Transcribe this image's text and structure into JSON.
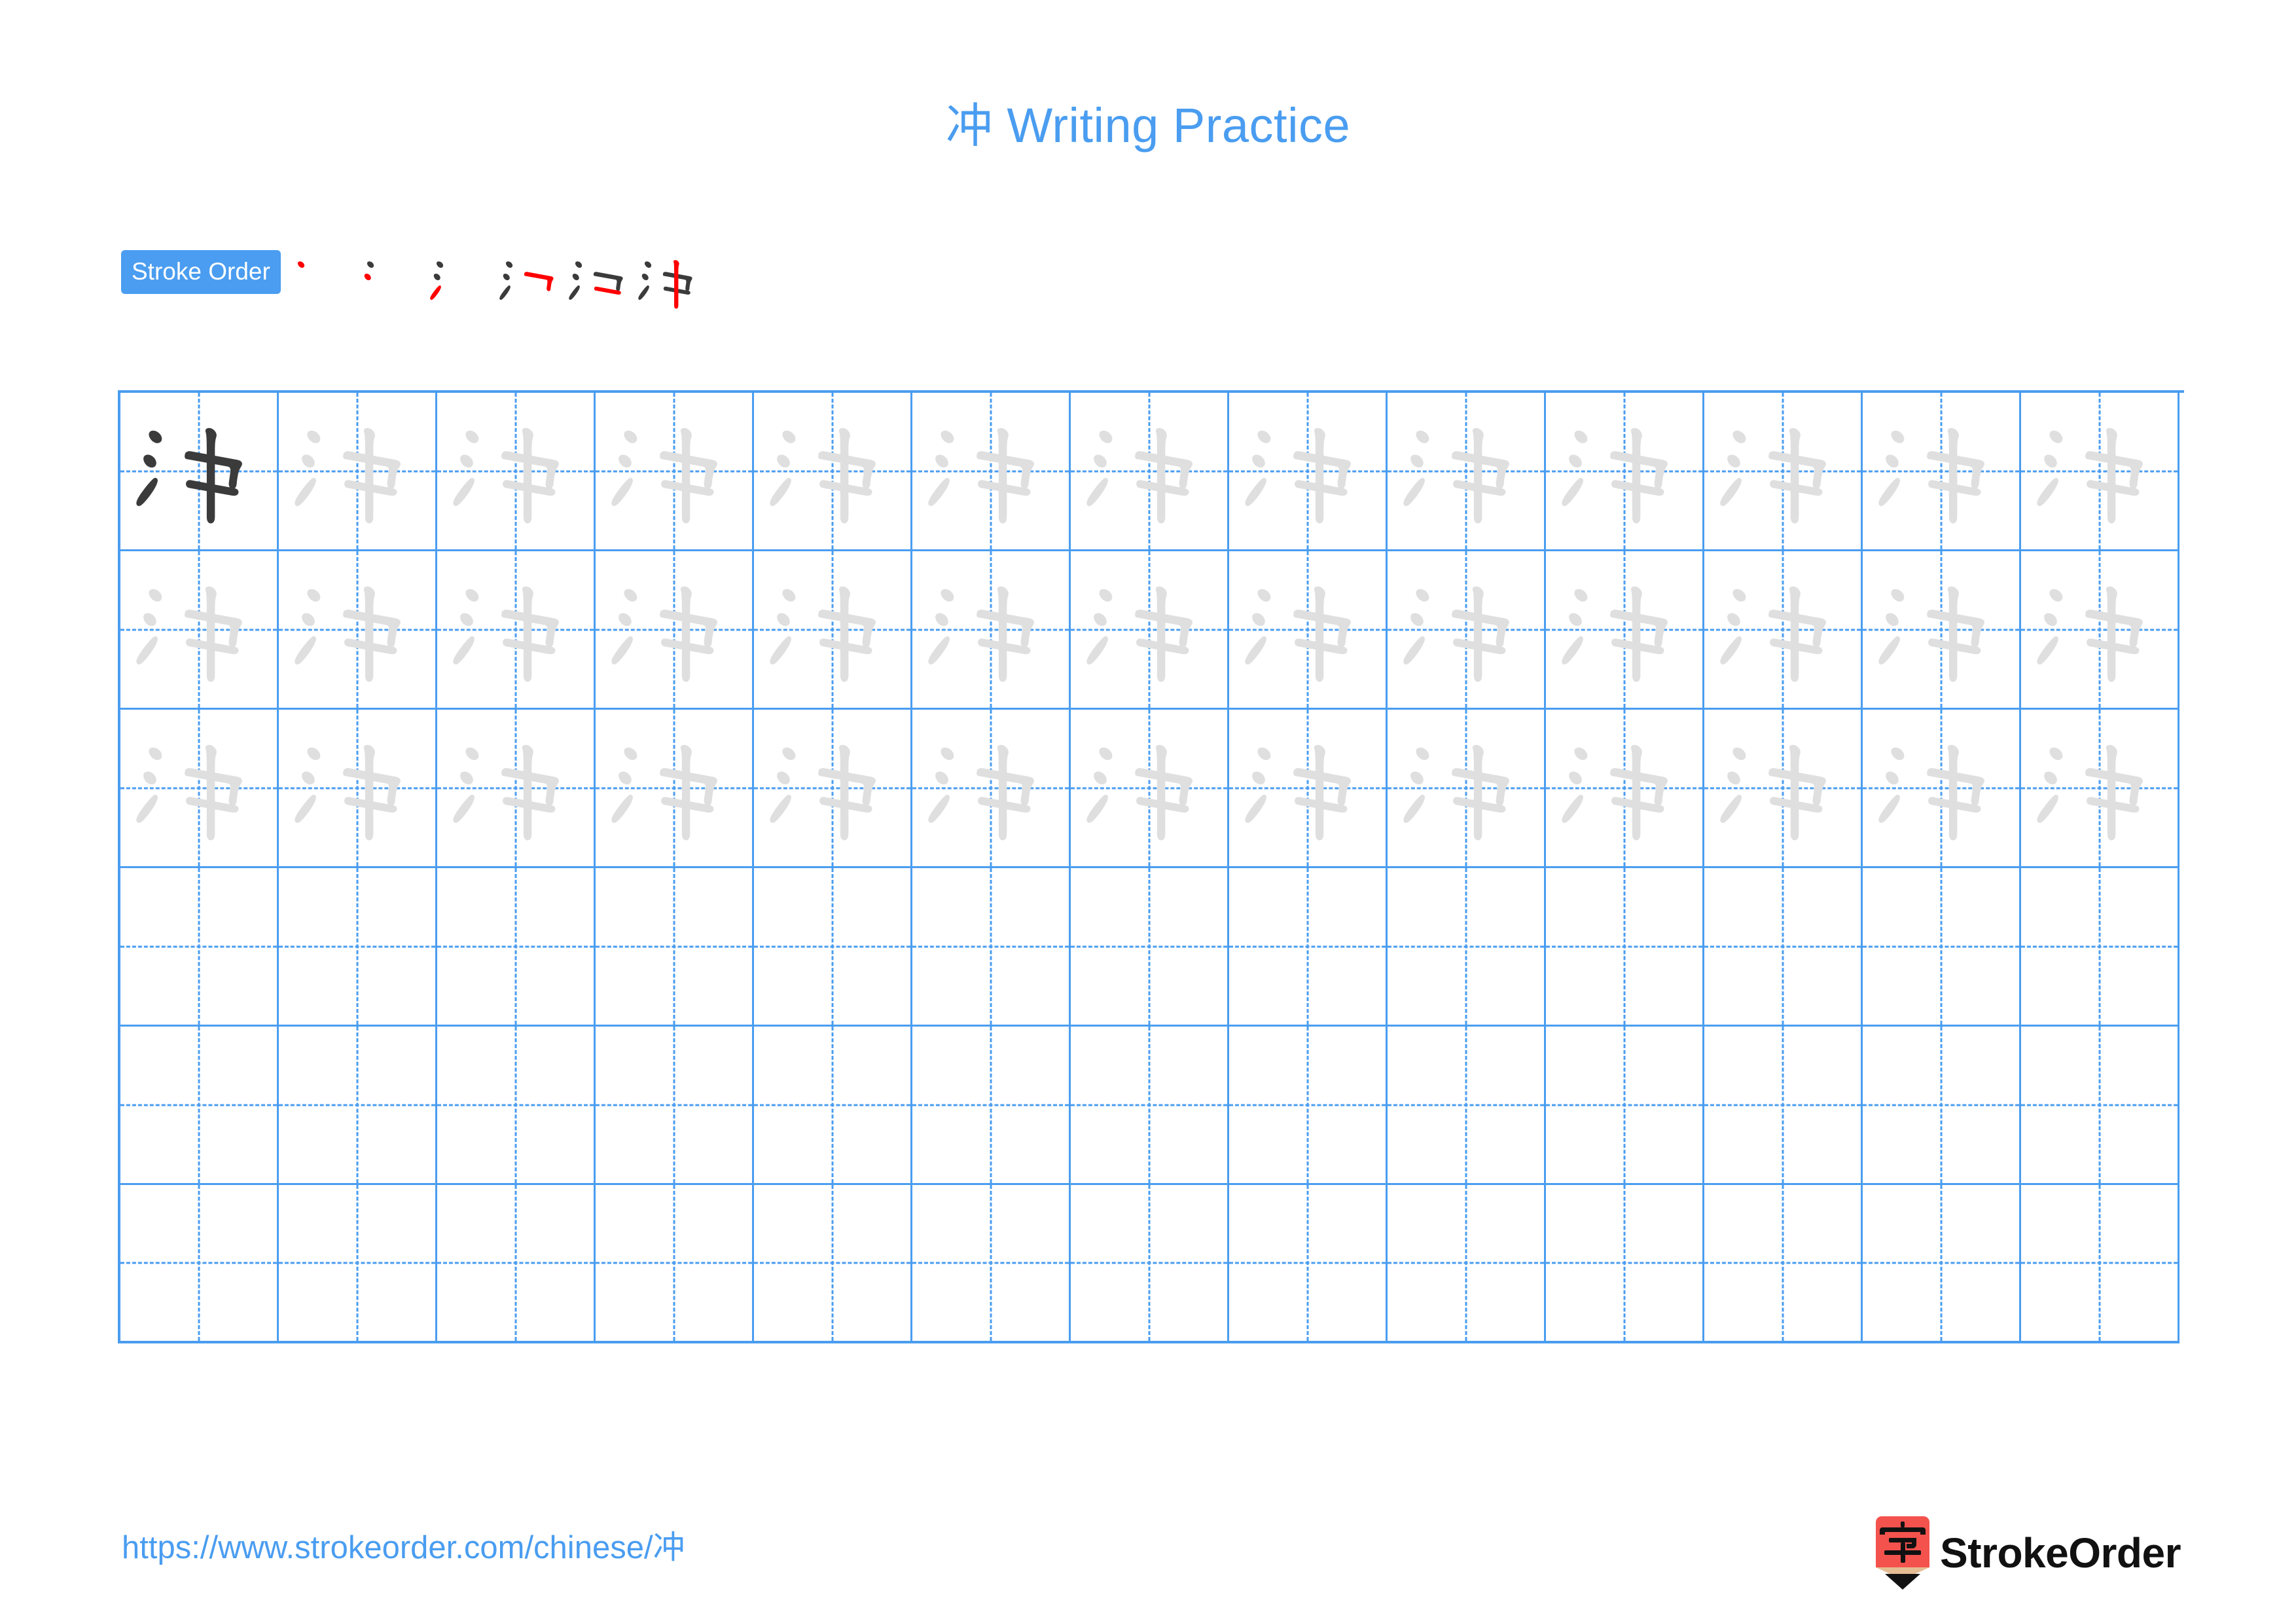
{
  "page": {
    "character": "冲",
    "title": "冲 Writing Practice",
    "title_char": "冲",
    "title_rest": " Writing Practice",
    "accent_blue": "#4A9DF0",
    "stroke_new_color": "#FF0000",
    "stroke_done_color": "#3B3B3B",
    "trace_gray": "#DFDFDF",
    "model_dark": "#3B3B3B",
    "background": "#FFFFFF"
  },
  "stroke_order": {
    "badge_label": "Stroke Order",
    "stroke_count": 6,
    "steps": [
      {
        "index": 1,
        "strokes_shown": 1,
        "new_stroke": 1,
        "name": "dian"
      },
      {
        "index": 2,
        "strokes_shown": 2,
        "new_stroke": 2,
        "name": "ti"
      },
      {
        "index": 3,
        "strokes_shown": 3,
        "new_stroke": 3,
        "name": "ti"
      },
      {
        "index": 4,
        "strokes_shown": 4,
        "new_stroke": 4,
        "name": "shu"
      },
      {
        "index": 5,
        "strokes_shown": 5,
        "new_stroke": 5,
        "name": "heng"
      },
      {
        "index": 6,
        "strokes_shown": 6,
        "new_stroke": 6,
        "name": "shu"
      }
    ]
  },
  "grid": {
    "columns": 13,
    "rows": 6,
    "cell_size_px": 242,
    "border_color": "#4A9DF0",
    "guide_style": "dashed-crosshair",
    "rows_content": [
      [
        "model",
        "trace",
        "trace",
        "trace",
        "trace",
        "trace",
        "trace",
        "trace",
        "trace",
        "trace",
        "trace",
        "trace",
        "trace"
      ],
      [
        "trace",
        "trace",
        "trace",
        "trace",
        "trace",
        "trace",
        "trace",
        "trace",
        "trace",
        "trace",
        "trace",
        "trace",
        "trace"
      ],
      [
        "trace",
        "trace",
        "trace",
        "trace",
        "trace",
        "trace",
        "trace",
        "trace",
        "trace",
        "trace",
        "trace",
        "trace",
        "trace"
      ],
      [
        "empty",
        "empty",
        "empty",
        "empty",
        "empty",
        "empty",
        "empty",
        "empty",
        "empty",
        "empty",
        "empty",
        "empty",
        "empty"
      ],
      [
        "empty",
        "empty",
        "empty",
        "empty",
        "empty",
        "empty",
        "empty",
        "empty",
        "empty",
        "empty",
        "empty",
        "empty",
        "empty"
      ],
      [
        "empty",
        "empty",
        "empty",
        "empty",
        "empty",
        "empty",
        "empty",
        "empty",
        "empty",
        "empty",
        "empty",
        "empty",
        "empty"
      ]
    ]
  },
  "footer": {
    "url": "https://www.strokeorder.com/chinese/冲",
    "brand_name": "StrokeOrder",
    "brand_mark_char": "字",
    "brand_mark_bg": "#F4524D",
    "brand_mark_wood": "#E4BD93",
    "brand_mark_tip": "#111111"
  }
}
